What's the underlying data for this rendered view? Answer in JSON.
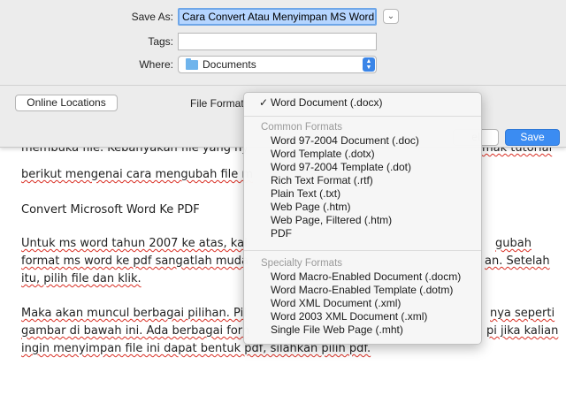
{
  "document": {
    "lines": [
      {
        "segments": [
          {
            "t": "membuka file. Kebanyakan file yang ny",
            "u": false
          },
          {
            "t": "",
            "u": false
          }
        ],
        "right": {
          "t": "mak tutorial",
          "u": true
        }
      },
      {
        "segments": [
          {
            "t": "berikut mengenai cara mengubah file m",
            "u": false
          }
        ],
        "right": null
      },
      {
        "segments": [
          {
            "t": "Convert Microsoft Word Ke PDF",
            "u": false
          }
        ],
        "right": null
      },
      {
        "segments": [
          {
            "t": "Untuk ms word tahun 2007 ke atas, kal",
            "u": false
          }
        ],
        "right": {
          "t": "gubah",
          "u": true
        }
      },
      {
        "segments": [
          {
            "t": "format ms word ke pdf sangatlah muda",
            "u": false
          }
        ],
        "right": {
          "t": "an. Setelah",
          "u": false
        }
      },
      {
        "segments": [
          {
            "t": "itu, pilih file dan klik.",
            "u": false
          }
        ],
        "right": null
      },
      {
        "segments": [
          {
            "t": "Maka akan muncul berbagai pilihan. Pil",
            "u": false
          }
        ],
        "right": {
          "t": "nya seperti",
          "u": false
        }
      },
      {
        "segments": [
          {
            "t": "gambar di bawah ini. Ada berbagai forn",
            "u": false
          }
        ],
        "right": {
          "t": "pi jika kalian",
          "u": false
        }
      },
      {
        "segments": [
          {
            "t": "ingin menyimpan file ini dapat bentuk pdf, silahkan pilih pdf.",
            "u": false
          }
        ],
        "right": null
      }
    ]
  },
  "sheet": {
    "save_as_label": "Save As:",
    "save_as_value": "Cara Convert Atau Menyimpan MS Word",
    "tags_label": "Tags:",
    "tags_value": "",
    "where_label": "Where:",
    "where_value": "Documents",
    "online_locations": "Online Locations",
    "file_format_label": "File Format",
    "cancel_label": "el",
    "save_label": "Save"
  },
  "format_menu": {
    "selected": "Word Document (.docx)",
    "groups": [
      {
        "header": "Common Formats",
        "items": [
          "Word 97-2004 Document (.doc)",
          "Word Template (.dotx)",
          "Word 97-2004 Template (.dot)",
          "Rich Text Format (.rtf)",
          "Plain Text (.txt)",
          "Web Page (.htm)",
          "Web Page, Filtered (.htm)",
          "PDF"
        ]
      },
      {
        "header": "Specialty Formats",
        "items": [
          "Word Macro-Enabled Document (.docm)",
          "Word Macro-Enabled Template (.dotm)",
          "Word XML Document (.xml)",
          "Word 2003 XML Document (.xml)",
          "Single File Web Page (.mht)"
        ]
      }
    ]
  },
  "colors": {
    "accent": "#3b8cf2",
    "menu_bg": "#f6f6f6",
    "sheet_bg": "#ececec"
  }
}
